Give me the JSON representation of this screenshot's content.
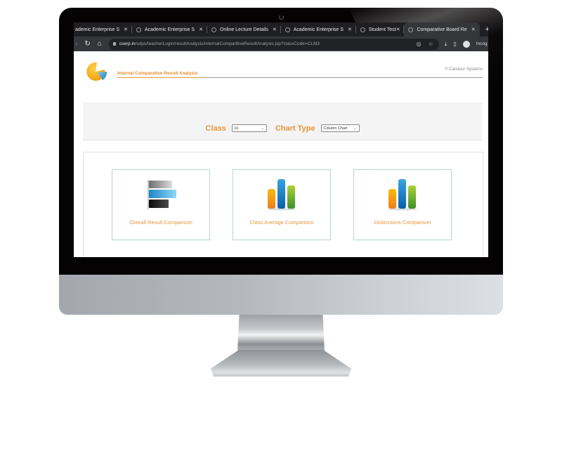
{
  "browser": {
    "tabs": [
      {
        "label": "ademic Enterprise S",
        "active": false
      },
      {
        "label": "Academic Enterprise S",
        "active": false
      },
      {
        "label": "Online Lecture Details",
        "active": false
      },
      {
        "label": "Academic Enterprise S",
        "active": false
      },
      {
        "label": "Student Test",
        "active": false
      },
      {
        "label": "Comparative Board Re",
        "active": true
      }
    ],
    "new_tab": "+",
    "url_host": "cserp.in",
    "url_path": "/sdps/teacherLogin/resultAnalysis/internalComparitiveResultAnalysis.jsp?classCode=CLM3",
    "profile_label": "Incog"
  },
  "header": {
    "title": "Internal Comparative Result Analysis",
    "copyright": "© Candour Systems"
  },
  "filters": {
    "class_label": "Class",
    "class_value": "III",
    "chart_type_label": "Chart Type",
    "chart_type_value": "Column Chart"
  },
  "cards": [
    {
      "label": "Overall Result Comparison",
      "icon": "horizontal-bar-chart-icon"
    },
    {
      "label": "Class Average Comparison",
      "icon": "column-chart-icon"
    },
    {
      "label": "Distinctions Comparison",
      "icon": "column-chart-icon"
    }
  ],
  "colors": {
    "accent": "#e8953a",
    "card_border": "#b6d5cf"
  }
}
